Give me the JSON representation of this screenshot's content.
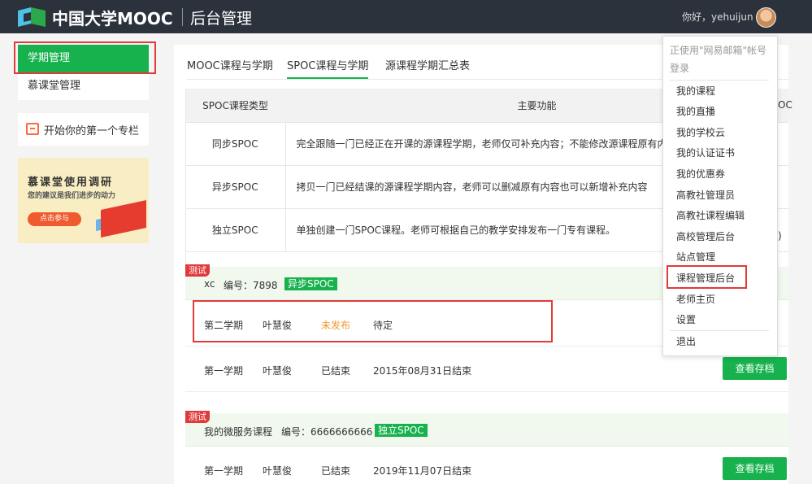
{
  "header": {
    "brand": "中国大学MOOC",
    "section": "后台管理",
    "greeting": "你好，yehuijun"
  },
  "sidebar": {
    "items": [
      {
        "label": "学期管理",
        "active": true
      },
      {
        "label": "慕课堂管理",
        "active": false
      }
    ],
    "column_card": "开始你的第一个专栏",
    "survey": {
      "title": "慕课堂使用调研",
      "subtitle": "您的建议是我们进步的动力",
      "button": "点击参与"
    }
  },
  "tabs": [
    {
      "label": "MOOC课程与学期",
      "active": false
    },
    {
      "label": "SPOC课程与学期",
      "active": true
    },
    {
      "label": "源课程学期汇总表",
      "active": false
    }
  ],
  "feature_table": {
    "headers": [
      "SPOC课程类型",
      "主要功能"
    ],
    "header_right_fragment": "OC",
    "rows": [
      {
        "type": "同步SPOC",
        "desc": "完全跟随一门已经正在开课的源课程学期，老师仅可补充内容；不能修改源课程原有内容"
      },
      {
        "type": "异步SPOC",
        "desc": "拷贝一门已经结课的源课程学期内容，老师可以删减原有内容也可以新增补充内容"
      },
      {
        "type": "独立SPOC",
        "desc": "单独创建一门SPOC课程。老师可根据自己的教学安排发布一门专有课程。"
      }
    ],
    "row3_right_fragment": ")"
  },
  "courses": [
    {
      "tag": "测试",
      "name": "xc",
      "number": "编号：7898",
      "badge": "异步SPOC",
      "terms": [
        {
          "term": "第二学期",
          "teacher": "叶慧俊",
          "status": "未发布",
          "info": "待定",
          "action": ""
        },
        {
          "term": "第一学期",
          "teacher": "叶慧俊",
          "status": "已结束",
          "info": "2015年08月31日结束",
          "action": "查看存档"
        }
      ]
    },
    {
      "tag": "测试",
      "name": "我的微服务课程",
      "number": "编号：6666666666",
      "badge": "独立SPOC",
      "terms": [
        {
          "term": "第一学期",
          "teacher": "叶慧俊",
          "status": "已结束",
          "info": "2019年11月07日结束",
          "action": "查看存档"
        }
      ]
    }
  ],
  "dropdown": {
    "notice": "正使用\"网易邮箱\"帐号登录",
    "items": [
      "我的课程",
      "我的直播",
      "我的学校云",
      "我的认证证书",
      "我的优惠券",
      "高教社管理员",
      "高教社课程编辑",
      "高校管理后台",
      "站点管理",
      "课程管理后台",
      "老师主页",
      "设置"
    ],
    "logout": "退出"
  },
  "colors": {
    "header_bg": "#2b323c",
    "accent_green": "#17b24d",
    "highlight_red": "#e23a3a",
    "unpublished_orange": "#f39a2e"
  }
}
